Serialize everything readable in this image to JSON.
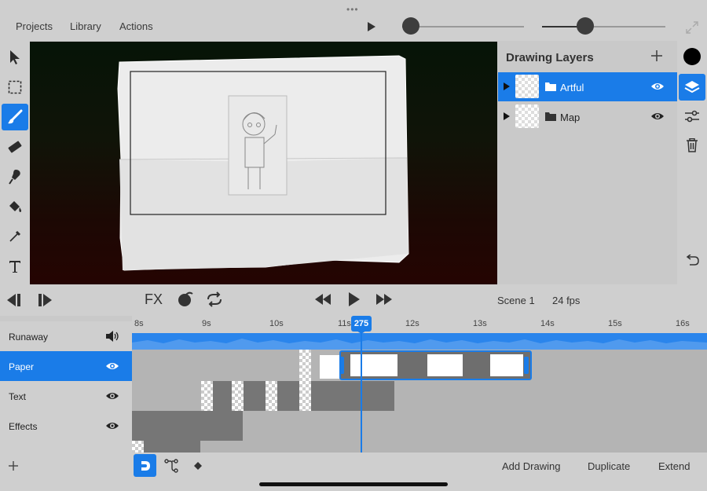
{
  "menu": {
    "projects": "Projects",
    "library": "Library",
    "actions": "Actions"
  },
  "top_sliders": {
    "left_value": 0.05,
    "right_value": 0.35
  },
  "layers_panel": {
    "title": "Drawing Layers",
    "layers": [
      {
        "name": "Artful",
        "selected": true,
        "visible": true
      },
      {
        "name": "Map",
        "selected": false,
        "visible": true
      }
    ]
  },
  "transport": {
    "fx_label": "FX",
    "scene": "Scene 1",
    "fps": "24 fps"
  },
  "timeline": {
    "ticks": [
      "8s",
      "9s",
      "10s",
      "11s",
      "12s",
      "13s",
      "14s",
      "15s",
      "16s"
    ],
    "current_frame": "275",
    "tracks": [
      {
        "name": "Runaway",
        "icon": "speaker-icon",
        "selected": false
      },
      {
        "name": "Paper",
        "icon": "eye-icon",
        "selected": true
      },
      {
        "name": "Text",
        "icon": "eye-icon",
        "selected": false
      },
      {
        "name": "Effects",
        "icon": "eye-icon",
        "selected": false
      }
    ]
  },
  "bottom": {
    "add_drawing": "Add Drawing",
    "duplicate": "Duplicate",
    "extend": "Extend"
  },
  "colors": {
    "accent": "#1a7ce8",
    "current_color": "#000000"
  }
}
